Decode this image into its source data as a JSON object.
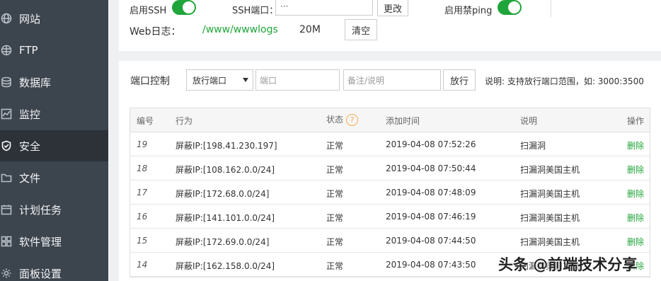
{
  "sidebar": {
    "items": [
      {
        "label": "网站",
        "icon": "globe-icon"
      },
      {
        "label": "FTP",
        "icon": "ftp-globe-icon"
      },
      {
        "label": "数据库",
        "icon": "database-icon"
      },
      {
        "label": "监控",
        "icon": "monitor-icon"
      },
      {
        "label": "安全",
        "icon": "shield-icon",
        "active": true
      },
      {
        "label": "文件",
        "icon": "folder-icon"
      },
      {
        "label": "计划任务",
        "icon": "calendar-icon"
      },
      {
        "label": "软件管理",
        "icon": "grid-icon"
      },
      {
        "label": "面板设置",
        "icon": "gear-icon"
      }
    ]
  },
  "top": {
    "ssh_label": "启用SSH",
    "ssh_port_label": "SSH端口：",
    "ssh_port_value": "···",
    "change_button": "更改",
    "ping_label": "启用禁ping",
    "web_log_label": "Web日志：",
    "web_log_path": "/www/wwwlogs",
    "web_log_size": "20M",
    "clear_button": "清空",
    "colors": {
      "toggle_on": "#20a53a",
      "path_green": "#20a53a"
    }
  },
  "port": {
    "title": "端口控制",
    "select_value": "放行端口",
    "port_placeholder": "端口",
    "remark_placeholder": "备注/说明",
    "allow_button": "放行",
    "hint": "说明: 支持放行端口范围，如: 3000:3500"
  },
  "table": {
    "headers": {
      "id": "编号",
      "action": "行为",
      "status": "状态",
      "status_help": "?",
      "time": "添加时间",
      "remark": "说明",
      "op": "操作"
    },
    "rows": [
      {
        "id": "19",
        "action": "屏蔽IP:[198.41.230.197]",
        "status": "正常",
        "time": "2019-04-08 07:52:26",
        "remark": "扫漏洞",
        "op": "删除"
      },
      {
        "id": "18",
        "action": "屏蔽IP:[108.162.0.0/24]",
        "status": "正常",
        "time": "2019-04-08 07:50:44",
        "remark": "扫漏洞美国主机",
        "op": "删除"
      },
      {
        "id": "17",
        "action": "屏蔽IP:[172.68.0.0/24]",
        "status": "正常",
        "time": "2019-04-08 07:48:09",
        "remark": "扫漏洞美国主机",
        "op": "删除"
      },
      {
        "id": "16",
        "action": "屏蔽IP:[141.101.0.0/24]",
        "status": "正常",
        "time": "2019-04-08 07:46:19",
        "remark": "扫漏洞美国主机",
        "op": "删除"
      },
      {
        "id": "15",
        "action": "屏蔽IP:[172.69.0.0/24]",
        "status": "正常",
        "time": "2019-04-08 07:44:50",
        "remark": "扫漏洞美国主机",
        "op": "删除"
      },
      {
        "id": "14",
        "action": "屏蔽IP:[162.158.0.0/24]",
        "status": "正常",
        "time": "2019-04-08 07:43:50",
        "remark": "扫漏洞美国主机",
        "op": "删除"
      }
    ]
  },
  "watermark": "头条 @前端技术分享"
}
